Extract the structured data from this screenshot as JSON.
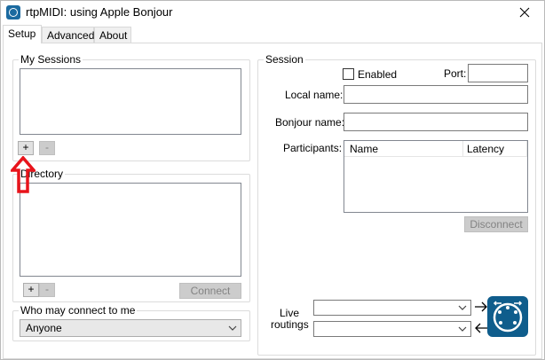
{
  "window": {
    "title": "rtpMIDI: using Apple Bonjour"
  },
  "tabs": [
    {
      "label": "Setup",
      "active": true
    },
    {
      "label": "Advanced",
      "active": false
    },
    {
      "label": "About",
      "active": false
    }
  ],
  "my_sessions": {
    "title": "My Sessions",
    "add_label": "+",
    "remove_label": "-"
  },
  "directory": {
    "title": "Directory",
    "add_label": "+",
    "remove_label": "-",
    "connect_label": "Connect"
  },
  "who_may_connect": {
    "title": "Who may connect to me",
    "selected": "Anyone"
  },
  "session": {
    "title": "Session",
    "enabled_label": "Enabled",
    "enabled_checked": false,
    "port_label": "Port:",
    "port_value": "",
    "local_name_label": "Local name:",
    "local_name_value": "",
    "bonjour_name_label": "Bonjour name:",
    "bonjour_name_value": "",
    "participants_label": "Participants:",
    "participants_columns": [
      "Name",
      "Latency"
    ],
    "disconnect_label": "Disconnect",
    "live_routings_label_line1": "Live",
    "live_routings_label_line2": "routings",
    "routing_in_selected": "",
    "routing_out_selected": ""
  },
  "colors": {
    "annotation_arrow": "#e8141b",
    "midi_logo_bg": "#0f5d8c"
  }
}
